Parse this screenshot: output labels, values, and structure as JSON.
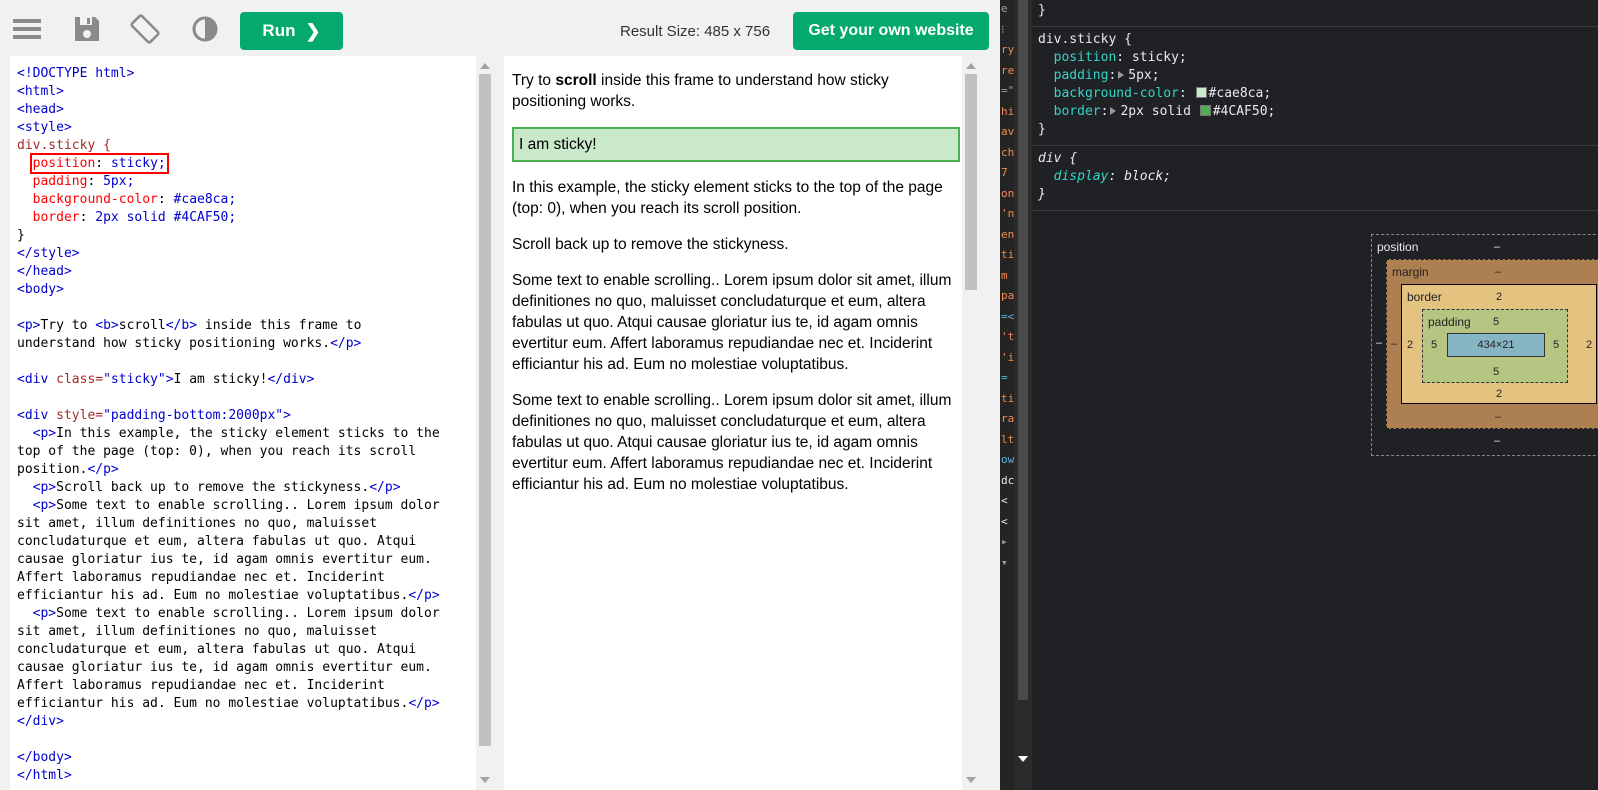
{
  "toolbar": {
    "icons": [
      "menu-icon",
      "save-icon",
      "rotate-icon",
      "contrast-icon"
    ],
    "run_label": "Run",
    "run_chevron": "❯",
    "result_size": "Result Size: 485 x 756",
    "get_site_label": "Get your own website"
  },
  "code": {
    "l1": "<!DOCTYPE html>",
    "l2": "<html>",
    "l3": "<head>",
    "l4": "<style>",
    "l5": "div.sticky {",
    "l6_prop": "position",
    "l6_val": "sticky;",
    "l7_prop": "padding",
    "l7_val": "5px;",
    "l8_prop": "background-color",
    "l8_val": "#cae8ca;",
    "l9_prop": "border",
    "l9_val": "2px solid #4CAF50;",
    "l10": "}",
    "l11": "</style>",
    "l12": "</head>",
    "l13": "<body>",
    "l15a": "<p>",
    "l15b": "Try to ",
    "l15c": "<b>",
    "l15d": "scroll",
    "l15e": "</b>",
    "l15f": " inside this frame to",
    "l16a": "understand how sticky positioning works.",
    "l16b": "</p>",
    "l18a": "<div ",
    "l18b": "class=",
    "l18c": "\"sticky\"",
    "l18d": ">",
    "l18e": "I am sticky!",
    "l18f": "</div>",
    "l20a": "<div ",
    "l20b": "style=",
    "l20c": "\"padding-bottom:2000px\"",
    "l20d": ">",
    "l21a": "<p>",
    "l21b": "In this example, the sticky element sticks to the",
    "l22": "top of the page (top: 0), when you reach its scroll",
    "l23a": "position.",
    "l23b": "</p>",
    "l24a": "<p>",
    "l24b": "Scroll back up to remove the stickyness.",
    "l24c": "</p>",
    "p_open": "<p>",
    "p_close": "</p>",
    "lorem1": "Some text to enable scrolling.. Lorem ipsum dolor",
    "lorem2": "sit amet, illum definitiones no quo, maluisset",
    "lorem3": "concludaturque et eum, altera fabulas ut quo. Atqui",
    "lorem4": "causae gloriatur ius te, id agam omnis evertitur eum.",
    "lorem5": "Affert laboramus repudiandae nec et. Inciderint",
    "lorem6": "efficiantur his ad. Eum no molestiae voluptatibus.",
    "div_close": "</div>",
    "body_close": "</body>",
    "html_close": "</html>"
  },
  "result": {
    "intro_pre": "Try to ",
    "intro_bold": "scroll",
    "intro_post": " inside this frame to understand how sticky positioning works.",
    "sticky": "I am sticky!",
    "p1": "In this example, the sticky element sticks to the top of the page (top: 0), when you reach its scroll position.",
    "p2": "Scroll back up to remove the stickyness.",
    "p3": "Some text to enable scrolling.. Lorem ipsum dolor sit amet, illum definitiones no quo, maluisset concludaturque et eum, altera fabulas ut quo. Atqui causae gloriatur ius te, id agam omnis evertitur eum. Affert laboramus repudiandae nec et. Inciderint efficiantur his ad. Eum no molestiae voluptatibus.",
    "p4": "Some text to enable scrolling.. Lorem ipsum dolor sit amet, illum definitiones no quo, maluisset concludaturque et eum, altera fabulas ut quo. Atqui causae gloriatur ius te, id agam omnis evertitur eum. Affert laboramus repudiandae nec et. Inciderint efficiantur his ad. Eum no molestiae voluptatibus."
  },
  "devtools": {
    "elements_fragments": [
      {
        "t": "e",
        "c": "#9aa0a6"
      },
      {
        "t": "⁝",
        "c": "#9aa0a6"
      },
      {
        "t": "ry",
        "c": "#f28b54"
      },
      {
        "t": "re",
        "c": "#f28b54"
      },
      {
        "t": "=\"",
        "c": "#9aa0a6"
      },
      {
        "t": "hi",
        "c": "#f28b54"
      },
      {
        "t": "av",
        "c": "#f28b54"
      },
      {
        "t": "ch",
        "c": "#f28b54"
      },
      {
        "t": " 7",
        "c": "#f28b54"
      },
      {
        "t": "on",
        "c": "#f28b54"
      },
      {
        "t": "'n",
        "c": "#f28b54"
      },
      {
        "t": "en",
        "c": "#f28b54"
      },
      {
        "t": "ti",
        "c": "#f28b54"
      },
      {
        "t": "m",
        "c": "#f28b54"
      },
      {
        "t": "pa",
        "c": "#f28b54"
      },
      {
        "t": "=<",
        "c": "#5db0d7"
      },
      {
        "t": "'t",
        "c": "#f28b54"
      },
      {
        "t": "'i",
        "c": "#f28b54"
      },
      {
        "t": "=",
        "c": "#5db0d7"
      },
      {
        "t": "ti",
        "c": "#f28b54"
      },
      {
        "t": "ra",
        "c": "#f28b54"
      },
      {
        "t": "lt",
        "c": "#f28b54"
      },
      {
        "t": "ow",
        "c": "#5db0d7"
      },
      {
        "t": "dc",
        "c": "#e8eaed"
      },
      {
        "t": "<",
        "c": "#e8eaed"
      },
      {
        "t": "<",
        "c": "#e8eaed"
      },
      {
        "t": "▸",
        "c": "#9aa0a6"
      },
      {
        "t": "▾",
        "c": "#9aa0a6"
      }
    ],
    "rule1_close": "}",
    "rule2": {
      "selector": "div.sticky {",
      "position_prop": "position",
      "position_val": " sticky;",
      "padding_prop": "padding",
      "padding_val": "5px;",
      "bg_prop": "background-color",
      "bg_val": "#cae8ca;",
      "border_prop": "border",
      "border_val_pre": "2px solid ",
      "border_val": "#4CAF50;",
      "close": "}"
    },
    "rule3": {
      "selector": "div {",
      "display_prop": "display",
      "display_val": " block;",
      "close": "}"
    },
    "swatch_bg": "#cae8ca",
    "swatch_border": "#4CAF50",
    "boxmodel": {
      "position_label": "position",
      "position_dash_top": "–",
      "position_dash_bottom": "–",
      "position_dash_left": "–",
      "position_dash_right": "–",
      "margin_label": "margin",
      "margin_top": "–",
      "margin_bottom": "–",
      "margin_left": "–",
      "margin_right": "–",
      "border_label": "border",
      "border_top": "2",
      "border_bottom": "2",
      "border_left": "2",
      "border_right": "2",
      "padding_label": "padding",
      "padding_top": "5",
      "padding_bottom": "5",
      "padding_left": "5",
      "padding_right": "5",
      "content": "434×21"
    }
  }
}
